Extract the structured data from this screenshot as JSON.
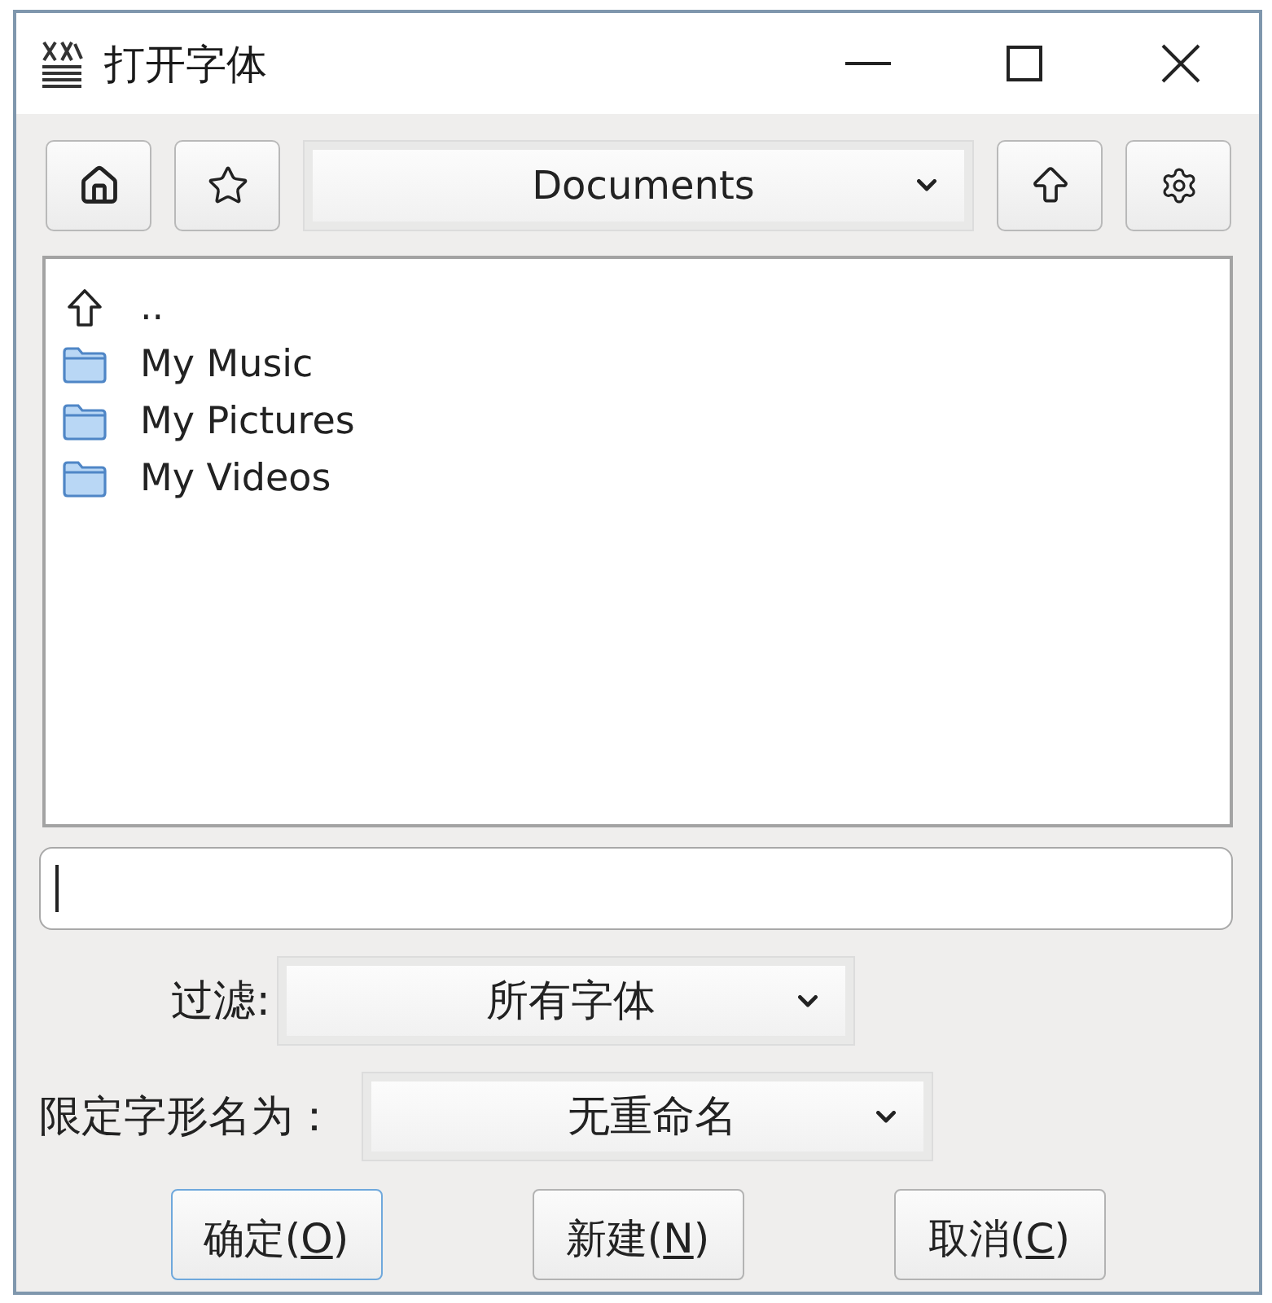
{
  "window": {
    "title": "打开字体",
    "controls": [
      {
        "kind": "minimize"
      },
      {
        "kind": "maximize"
      },
      {
        "kind": "close"
      }
    ]
  },
  "toolbar": {
    "left_buttons": [
      {
        "kind": "home"
      },
      {
        "kind": "bookmark"
      }
    ],
    "location": "Documents",
    "right_buttons": [
      {
        "kind": "up"
      },
      {
        "kind": "settings"
      }
    ]
  },
  "files": [
    {
      "kind": "parent",
      "name": ".."
    },
    {
      "kind": "folder",
      "name": "My Music"
    },
    {
      "kind": "folder",
      "name": "My Pictures"
    },
    {
      "kind": "folder",
      "name": "My Videos"
    }
  ],
  "filename_field": {
    "focused": true
  },
  "filter": {
    "label": "过滤:",
    "value": "所有字体"
  },
  "glyph_naming": {
    "label": "限定字形名为：",
    "value": "无重命名"
  },
  "buttons": [
    {
      "text_before": "确定(",
      "mnemonic": "O",
      "text_after": ")",
      "default": true
    },
    {
      "text_before": "新建(",
      "mnemonic": "N",
      "text_after": ")",
      "default": false
    },
    {
      "text_before": "取消(",
      "mnemonic": "C",
      "text_after": ")",
      "default": false
    }
  ]
}
